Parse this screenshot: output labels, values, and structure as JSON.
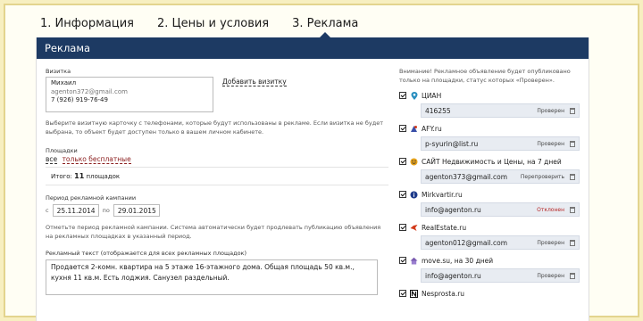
{
  "tabs": [
    {
      "label": "1. Информация"
    },
    {
      "label": "2. Цены и условия"
    },
    {
      "label": "3. Реклама"
    }
  ],
  "panel_title": "Реклама",
  "card": {
    "label": "Визитка",
    "name": "Михаил",
    "email": "agenton372@gmail.com",
    "phone": "7 (926) 919-76-49",
    "add_link": "Добавить визитку",
    "hint": "Выберите визитную карточку с телефонами, которые будут использованы в рекламе. Если визитка не будет выбрана, то объект будет доступен только в вашем личном кабинете."
  },
  "platforms": {
    "label": "Площадки",
    "all": "все",
    "free": "только бесплатные",
    "total_prefix": "Итого:",
    "total_count": "11",
    "total_suffix": "площадок"
  },
  "period": {
    "label": "Период рекламной кампании",
    "from_label": "с",
    "from": "25.11.2014",
    "to_label": "по",
    "to": "29.01.2015",
    "hint": "Отметьте период рекламной кампании. Система автоматически будет продлевать публикацию объявления на рекламных площадках в указанный период."
  },
  "ad_text": {
    "label": "Рекламный текст (отображается для всех рекламных площадок)",
    "value": "Продается 2-комн. квартира на 5 этаже 16-этажного дома. Общая площадь 50 кв.м., кухня 11 кв.м. Есть лоджия. Санузел раздельный."
  },
  "notice": "Внимание! Рекламное объявление будет опубликовано только на площадки, статус которых «Проверен».",
  "sites": [
    {
      "name": "ЦИАН",
      "value": "416255",
      "status": "Проверен",
      "status_color": "#444444",
      "icon": "map-pin",
      "icon_color": "#2a8fbf"
    },
    {
      "name": "AFY.ru",
      "value": "p-syurin@list.ru",
      "status": "Проверен",
      "status_color": "#444444",
      "icon": "afy-logo",
      "icon_color": "#3a4fa8"
    },
    {
      "name": "САЙТ Недвижимость и Цены, на 7 дней",
      "value": "agenton373@gmail.com",
      "status": "Перепроверить",
      "status_color": "#444444",
      "icon": "smile-logo",
      "icon_color": "#e6a21a"
    },
    {
      "name": "Mirkvartir.ru",
      "value": "info@agenton.ru",
      "status": "Отклонен",
      "status_color": "#b52222",
      "icon": "info-circle",
      "icon_color": "#1d3a8a"
    },
    {
      "name": "RealEstate.ru",
      "value": "agenton012@gmail.com",
      "status": "Проверен",
      "status_color": "#444444",
      "icon": "bird-logo",
      "icon_color": "#d23a1a"
    },
    {
      "name": "move.su, на 30 дней",
      "value": "info@agenton.ru",
      "status": "Проверен",
      "status_color": "#444444",
      "icon": "house-logo",
      "icon_color": "#7a5bb0"
    },
    {
      "name": "Nesprosta.ru",
      "value": "",
      "status": "",
      "status_color": "#444444",
      "icon": "n-logo",
      "icon_color": "#111111"
    }
  ]
}
